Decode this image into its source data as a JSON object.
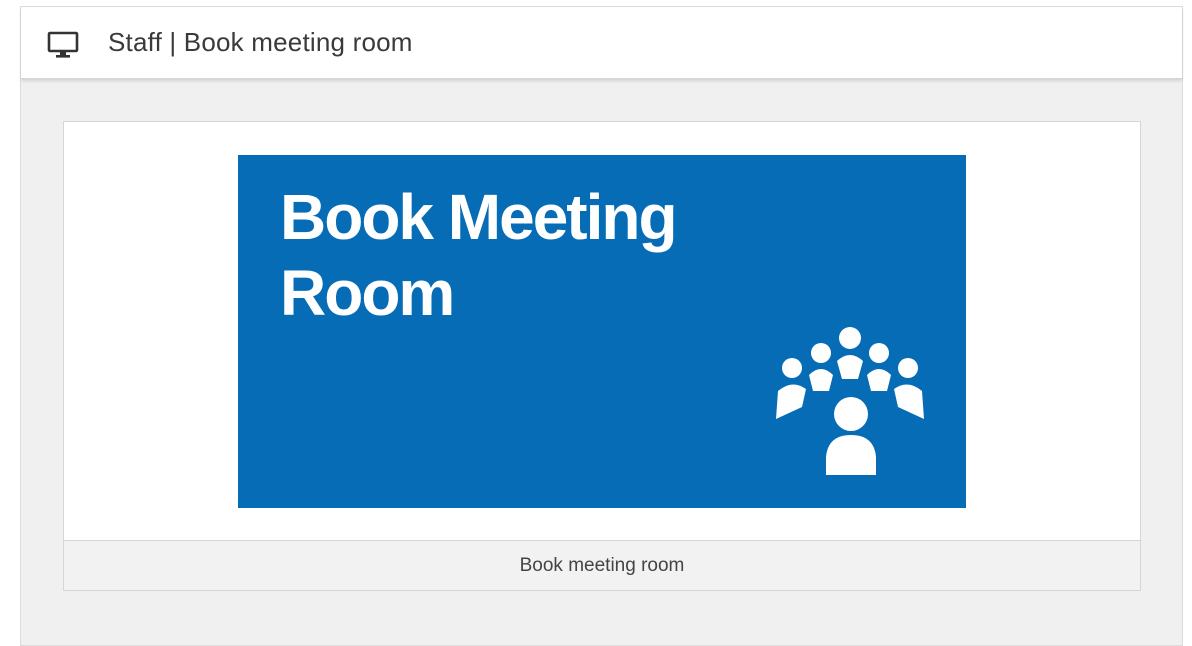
{
  "header": {
    "title": "Staff | Book meeting room",
    "icon": "monitor-icon"
  },
  "tile": {
    "banner_title": "Book Meeting\nRoom",
    "banner_icon": "meeting-people-icon",
    "banner_color": "#066cb5",
    "caption": "Book meeting room"
  }
}
